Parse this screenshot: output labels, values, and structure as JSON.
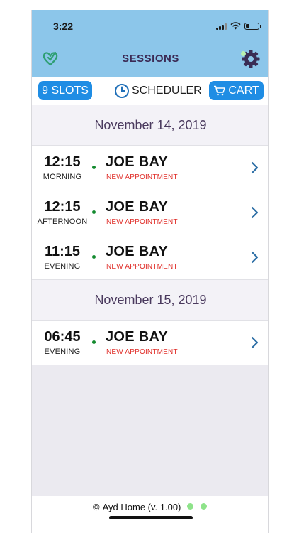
{
  "status_bar": {
    "time": "3:22"
  },
  "header": {
    "title": "SESSIONS",
    "logo_icon": "heart-logo-icon",
    "settings_icon": "gear-icon"
  },
  "toolbar": {
    "slots_label": "9 SLOTS",
    "scheduler_label": "SCHEDULER",
    "cart_label": "CART"
  },
  "sessions": [
    {
      "date": "November 14, 2019",
      "items": [
        {
          "time": "12:15",
          "period": "MORNING",
          "name": "JOE BAY",
          "status": "NEW APPOINTMENT"
        },
        {
          "time": "12:15",
          "period": "AFTERNOON",
          "name": "JOE BAY",
          "status": "NEW APPOINTMENT"
        },
        {
          "time": "11:15",
          "period": "EVENING",
          "name": "JOE BAY",
          "status": "NEW APPOINTMENT"
        }
      ]
    },
    {
      "date": "November 15, 2019",
      "items": [
        {
          "time": "06:45",
          "period": "EVENING",
          "name": "JOE BAY",
          "status": "NEW APPOINTMENT"
        }
      ]
    }
  ],
  "footer": {
    "copyright_symbol": "©",
    "text": "Ayd Home (v. 1.00)"
  },
  "colors": {
    "header_bg": "#8cc6ea",
    "accent_blue": "#1f8de4",
    "status_red": "#e0302b",
    "dot_green": "#138a2e"
  }
}
